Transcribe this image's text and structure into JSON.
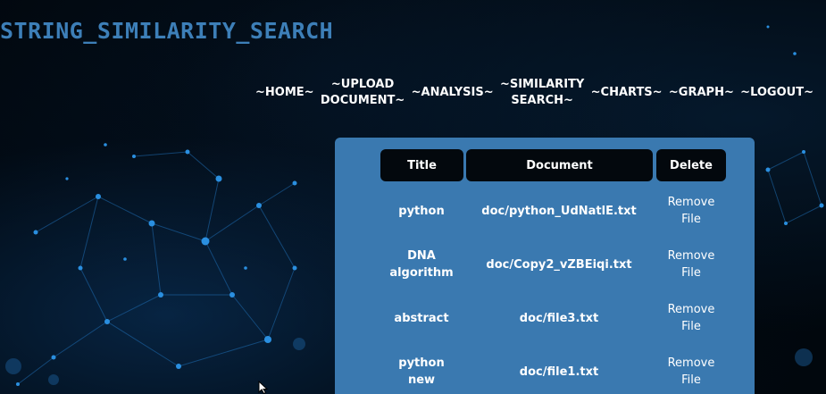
{
  "app": {
    "title": "STRING_SIMILARITY_SEARCH"
  },
  "nav": {
    "home": "~HOME~",
    "upload_line1": "~UPLOAD",
    "upload_line2": "DOCUMENT~",
    "analysis": "~ANALYSIS~",
    "similarity_line1": "~SIMILARITY",
    "similarity_line2": "SEARCH~",
    "charts": "~CHARTS~",
    "graph": "~GRAPH~",
    "logout": "~LOGOUT~"
  },
  "table": {
    "headers": {
      "title": "Title",
      "document": "Document",
      "delete": "Delete"
    },
    "rows": [
      {
        "title_line1": "python",
        "title_line2": "",
        "document": "doc/python_UdNatlE.txt",
        "delete_line1": "Remove",
        "delete_line2": "File"
      },
      {
        "title_line1": "DNA",
        "title_line2": "algorithm",
        "document": "doc/Copy2_vZBEiqi.txt",
        "delete_line1": "Remove",
        "delete_line2": "File"
      },
      {
        "title_line1": "abstract",
        "title_line2": "",
        "document": "doc/file3.txt",
        "delete_line1": "Remove",
        "delete_line2": "File"
      },
      {
        "title_line1": "python",
        "title_line2": "new",
        "document": "doc/file1.txt",
        "delete_line1": "Remove",
        "delete_line2": "File"
      }
    ]
  },
  "colors": {
    "brand": "#3d7fb8",
    "panel": "#3a79b0",
    "header_cell": "#03080d",
    "background": "#01070d",
    "network_node": "#2a8fe0"
  },
  "icons": {
    "background_art": "network-background",
    "pointer": "mouse-cursor-icon"
  }
}
